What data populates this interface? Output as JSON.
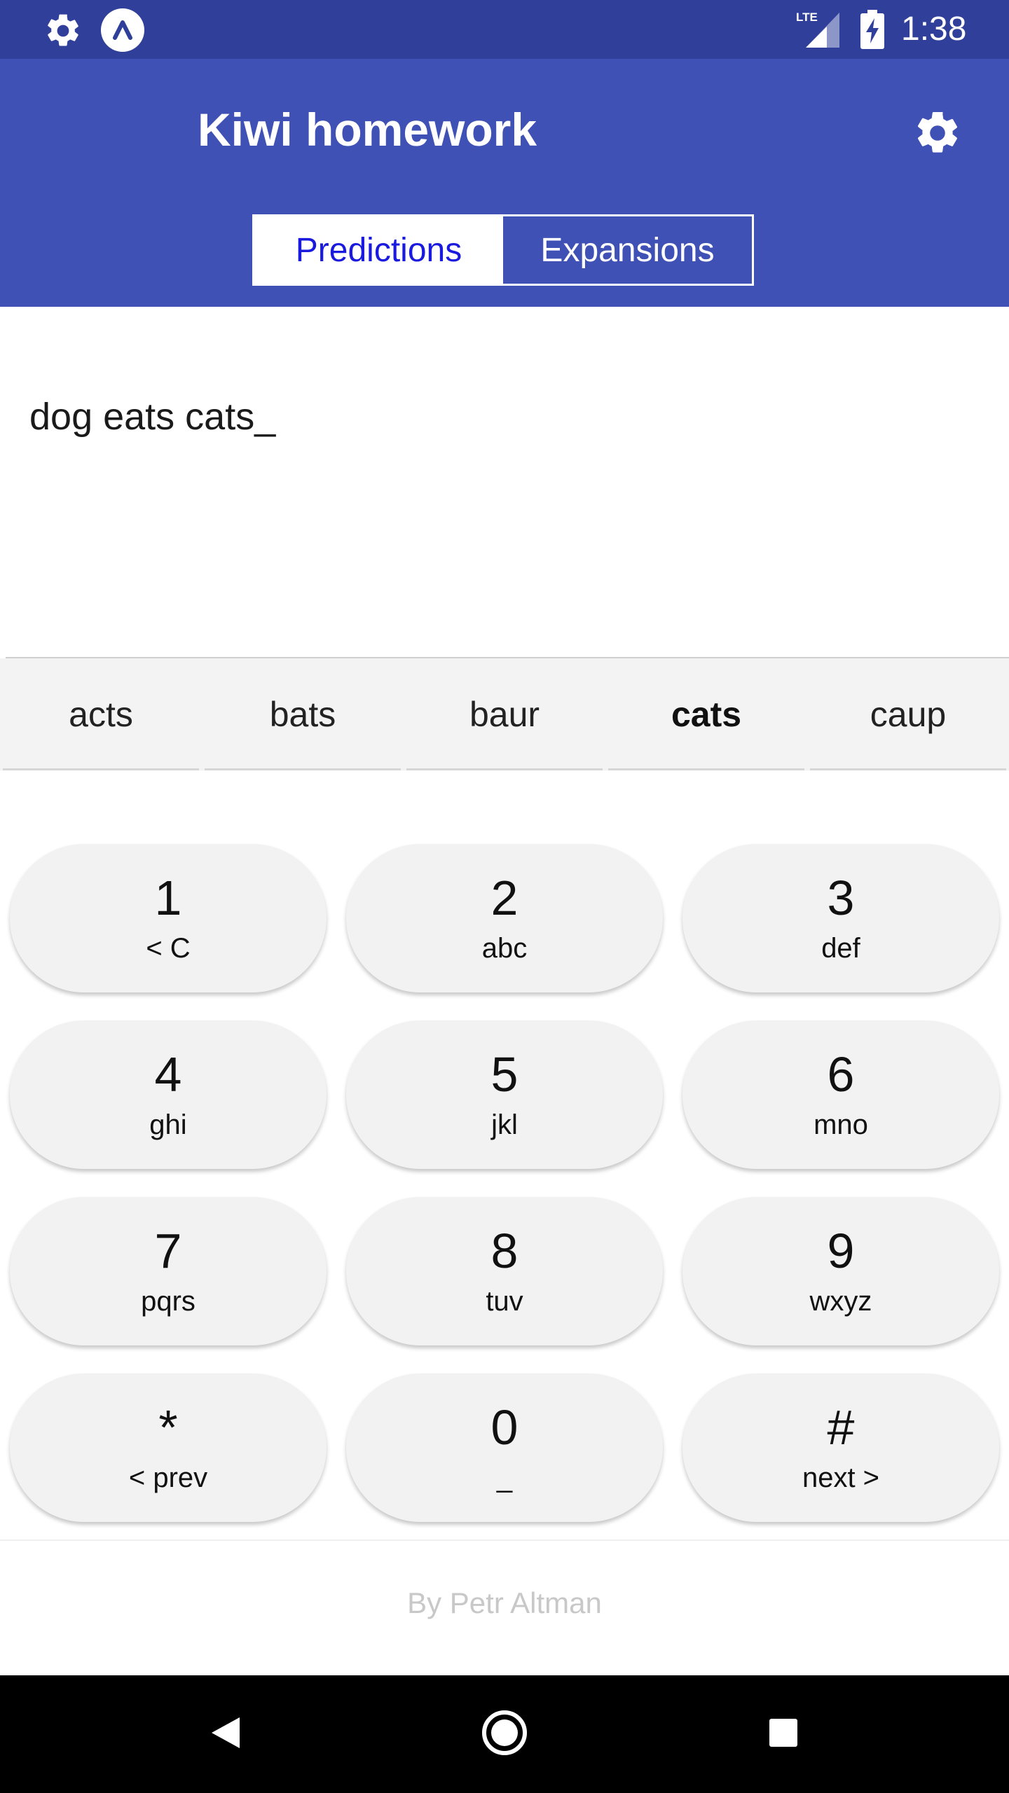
{
  "status_bar": {
    "time": "1:38",
    "network": "LTE",
    "icons": [
      "gear-icon",
      "app-notification-icon",
      "lte-signal-icon",
      "battery-charging-icon"
    ]
  },
  "app_bar": {
    "title": "Kiwi homework",
    "settings_icon": "gear-icon",
    "tabs": [
      {
        "label": "Predictions",
        "active": true
      },
      {
        "label": "Expansions",
        "active": false
      }
    ],
    "accent_color": "#3f51b5",
    "active_tab_text_color": "#1a1adf"
  },
  "input": {
    "text": "dog eats cats_"
  },
  "suggestions": [
    {
      "label": "acts",
      "selected": false
    },
    {
      "label": "bats",
      "selected": false
    },
    {
      "label": "baur",
      "selected": false
    },
    {
      "label": "cats",
      "selected": true
    },
    {
      "label": "caup",
      "selected": false
    }
  ],
  "keypad": [
    {
      "digit": "1",
      "letters": "< C"
    },
    {
      "digit": "2",
      "letters": "abc"
    },
    {
      "digit": "3",
      "letters": "def"
    },
    {
      "digit": "4",
      "letters": "ghi"
    },
    {
      "digit": "5",
      "letters": "jkl"
    },
    {
      "digit": "6",
      "letters": "mno"
    },
    {
      "digit": "7",
      "letters": "pqrs"
    },
    {
      "digit": "8",
      "letters": "tuv"
    },
    {
      "digit": "9",
      "letters": "wxyz"
    },
    {
      "digit": "*",
      "letters": "< prev"
    },
    {
      "digit": "0",
      "letters": "_"
    },
    {
      "digit": "#",
      "letters": "next >"
    }
  ],
  "footer": {
    "credit": "By Petr Altman"
  },
  "nav_bar": {
    "icons": [
      "back-icon",
      "home-icon",
      "recents-icon"
    ]
  }
}
